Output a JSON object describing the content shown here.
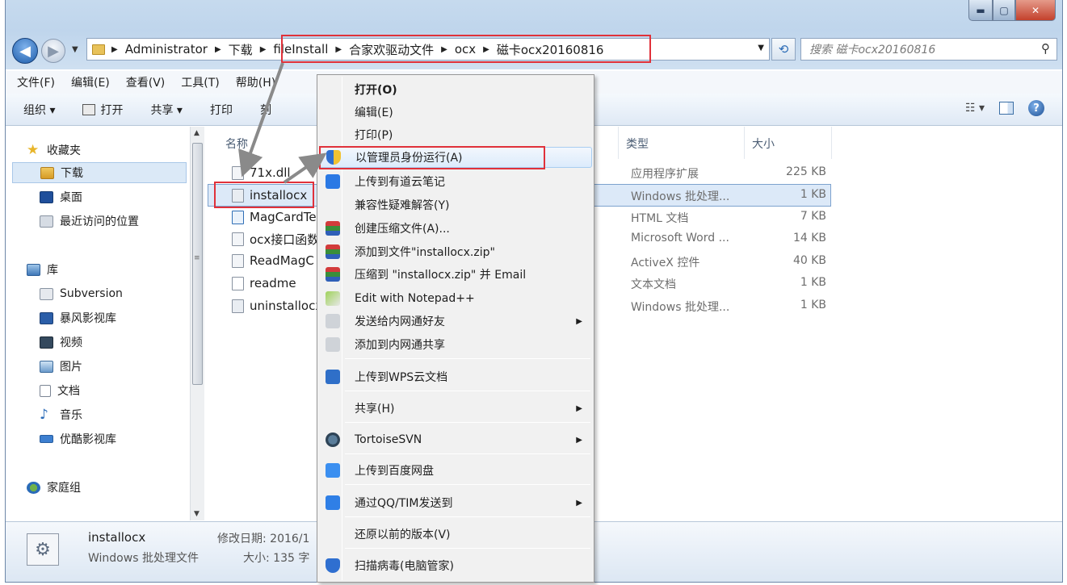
{
  "address": {
    "crumbs": [
      "Administrator",
      "下载",
      "fileInstall",
      "合家欢驱动文件",
      "ocx",
      "磁卡ocx20160816"
    ]
  },
  "search": {
    "placeholder": "搜索 磁卡ocx20160816"
  },
  "menubar": [
    "文件(F)",
    "编辑(E)",
    "查看(V)",
    "工具(T)",
    "帮助(H)"
  ],
  "toolbar": {
    "organize": "组织 ▾",
    "open": "打开",
    "share": "共享 ▾",
    "print": "打印",
    "burn": "刻"
  },
  "nav": {
    "favorites": "收藏夹",
    "downloads": "下载",
    "desktop": "桌面",
    "recent": "最近访问的位置",
    "libraries": "库",
    "subversion": "Subversion",
    "baofeng": "暴风影视库",
    "videos": "视频",
    "pictures": "图片",
    "documents": "文档",
    "music": "音乐",
    "youku": "优酷影视库",
    "homegroup": "家庭组"
  },
  "columns": {
    "name": "名称",
    "type": "类型",
    "size": "大小"
  },
  "files": [
    {
      "name": "71x.dll",
      "type": "应用程序扩展",
      "size": "225 KB"
    },
    {
      "name": "installocx",
      "type": "Windows 批处理...",
      "size": "1 KB"
    },
    {
      "name": "MagCardTe",
      "type": "HTML 文档",
      "size": "7 KB"
    },
    {
      "name": "ocx接口函数",
      "type": "Microsoft Word ...",
      "size": "14 KB"
    },
    {
      "name": "ReadMagC",
      "type": "ActiveX 控件",
      "size": "40 KB"
    },
    {
      "name": "readme",
      "type": "文本文档",
      "size": "1 KB"
    },
    {
      "name": "uninstallocx",
      "type": "Windows 批处理...",
      "size": "1 KB"
    }
  ],
  "details": {
    "name": "installocx",
    "type": "Windows 批处理文件",
    "modified": "修改日期: 2016/1",
    "size": "大小: 135 字"
  },
  "context_menu": {
    "open": "打开(O)",
    "edit": "编辑(E)",
    "print": "打印(P)",
    "run_as_admin": "以管理员身份运行(A)",
    "youdao": "上传到有道云笔记",
    "compat": "兼容性疑难解答(Y)",
    "create_archive": "创建压缩文件(A)...",
    "add_to_zip": "添加到文件\"installocx.zip\"",
    "zip_email": "压缩到 \"installocx.zip\" 并 Email",
    "notepad": "Edit with Notepad++",
    "send_intranet": "发送给内网通好友",
    "intranet_share": "添加到内网通共享",
    "wps": "上传到WPS云文档",
    "share": "共享(H)",
    "tortoise": "TortoiseSVN",
    "baidu": "上传到百度网盘",
    "qq": "通过QQ/TIM发送到",
    "restore": "还原以前的版本(V)",
    "scan": "扫描病毒(电脑管家)"
  },
  "colors": {
    "highlight": "#e0313a",
    "selection": "#dce9f8",
    "menu_hover": "#dcebfc"
  }
}
